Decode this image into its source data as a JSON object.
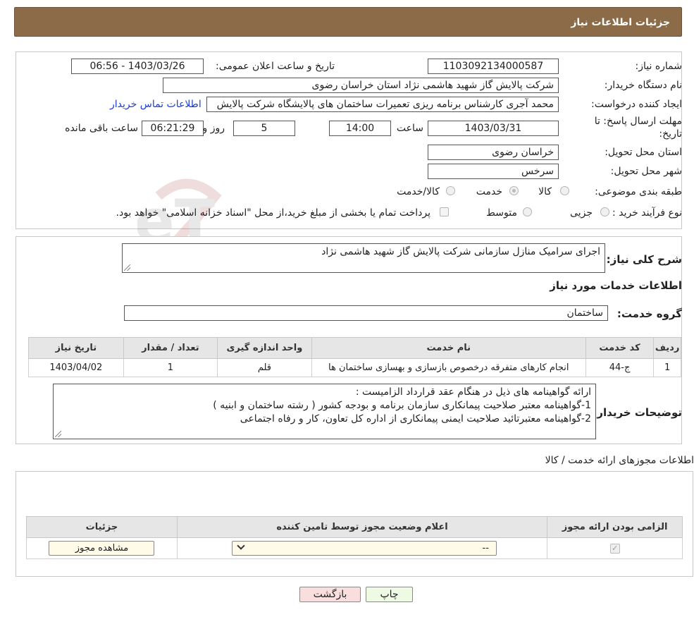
{
  "header": {
    "title": "جزئیات اطلاعات نیاز"
  },
  "info": {
    "need_number_label": "شماره نیاز:",
    "need_number": "1103092134000587",
    "announce_label": "تاریخ و ساعت اعلان عمومی:",
    "announce_value": "1403/03/26 - 06:56",
    "buyer_org_label": "نام دستگاه خریدار:",
    "buyer_org": "شرکت پالایش گاز شهید هاشمی نژاد   استان خراسان رضوی",
    "creator_label": "ایجاد کننده درخواست:",
    "creator": "محمد آجری کارشناس برنامه ریزی تعمیرات ساختمان های پالایشگاه شرکت پالایش",
    "contact_link": "اطلاعات تماس خریدار",
    "deadline_label_1": "مهلت ارسال پاسخ: تا",
    "deadline_label_2": "تاریخ:",
    "deadline_date": "1403/03/31",
    "time_label": "ساعت",
    "deadline_time": "14:00",
    "days_value": "5",
    "days_label": "روز و",
    "remaining_time": "06:21:29",
    "remaining_label": "ساعت باقی مانده",
    "province_label": "استان محل تحویل:",
    "province": "خراسان رضوی",
    "city_label": "شهر محل تحویل:",
    "city": "سرخس",
    "category_label": "طبقه بندی موضوعی:",
    "category_options": [
      "کالا",
      "خدمت",
      "کالا/خدمت"
    ],
    "category_selected": "خدمت",
    "process_label": "نوع فرآیند خرید :",
    "process_options": [
      "جزیی",
      "متوسط"
    ],
    "payment_note": "پرداخت تمام یا بخشی از مبلغ خرید،از محل \"اسناد خزانه اسلامی\" خواهد بود."
  },
  "description": {
    "label": "شرح کلی نیاز:",
    "text": "اجرای سرامیک منازل سازمانی شرکت پالایش گاز شهید هاشمی نژاد"
  },
  "services": {
    "section_title": "اطلاعات خدمات مورد نیاز",
    "group_label": "گروه خدمت:",
    "group_value": "ساختمان",
    "columns": [
      "ردیف",
      "کد خدمت",
      "نام خدمت",
      "واحد اندازه گیری",
      "تعداد / مقدار",
      "تاریخ نیاز"
    ],
    "rows": [
      [
        "1",
        "ج-44",
        "انجام کارهای متفرقه درخصوص بازسازی و بهسازی ساختمان ها",
        "قلم",
        "1",
        "1403/04/02"
      ]
    ]
  },
  "buyer_notes": {
    "label": "توضیحات خریدار:",
    "lines": [
      "ارائه گواهینامه های ذیل در هنگام عقد قرارداد الزامیست :",
      "1-گواهینامه معتبر صلاحیت پیمانکاری سازمان برنامه و بودجه کشور ( رشته ساختمان و ابنیه )",
      "2-گواهینامه معتبرتائید صلاحیت ایمنی پیمانکاری از اداره کل تعاون، کار و رفاه اجتماعی"
    ]
  },
  "licenses": {
    "section_title": "اطلاعات مجوزهای ارائه خدمت / کالا",
    "columns": [
      "الزامی بودن ارائه مجوز",
      "اعلام وضعیت مجوز توسط تامین کننده",
      "جزئیات"
    ],
    "select_value": "--",
    "view_button": "مشاهده مجوز"
  },
  "footer": {
    "print_label": "چاپ",
    "back_label": "بازگشت"
  },
  "watermark": {
    "text": "AriaTender.neT"
  },
  "colors": {
    "header_bg": "#8b6b48",
    "link": "#1a3fd1",
    "back_btn": "#f9dede",
    "print_btn": "#eefae4"
  }
}
